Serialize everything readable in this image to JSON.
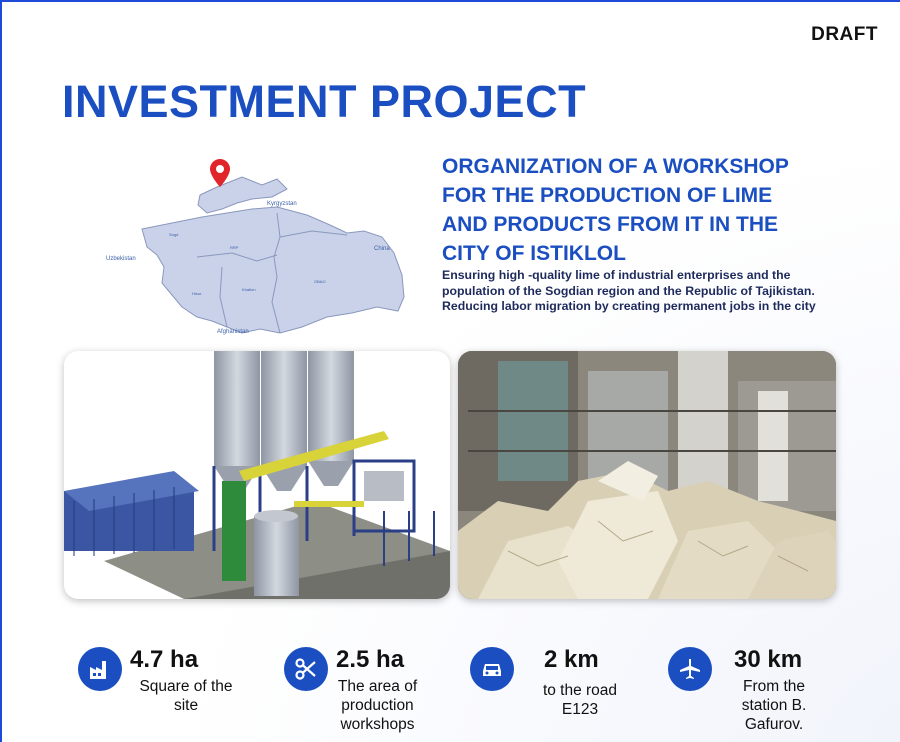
{
  "header": {
    "badge": "DRAFT",
    "title": "INVESTMENT PROJECT"
  },
  "map": {
    "labels": {
      "kyrgyzstan": "Kyrgyzstan",
      "uzbekistan": "Uzbekistan",
      "china": "China",
      "afghanistan": "Afghanistan",
      "sogd": "Sogd",
      "hisor": "Hisor",
      "khatlon": "Khatlon",
      "gbao": "GBAO",
      "rrp": "RRP"
    },
    "colors": {
      "fill": "#c9d2e8",
      "stroke": "#8a98bd",
      "pin": "#e0262b"
    }
  },
  "project": {
    "heading_lines": [
      "ORGANIZATION OF A WORKSHOP",
      "FOR THE PRODUCTION OF LIME",
      "AND PRODUCTS FROM IT IN THE",
      "CITY OF ISTIKLOL"
    ],
    "description": [
      "Ensuring high -quality lime of industrial enterprises and the population of the Sogdian region and the Republic of Tajikistan.",
      "Reducing labor migration by creating permanent jobs in the city"
    ]
  },
  "stats": [
    {
      "icon": "factory-icon",
      "value": "4.7 ha",
      "label_lines": [
        "Square of the",
        "site"
      ]
    },
    {
      "icon": "scissors-icon",
      "value": "2.5 ha",
      "label_lines": [
        "The area of",
        "production",
        "workshops"
      ]
    },
    {
      "icon": "car-icon",
      "value": "2 km",
      "label_lines": [
        "to the road",
        "E123"
      ]
    },
    {
      "icon": "airplane-icon",
      "value": "30 km",
      "label_lines": [
        "From the",
        "station B.",
        "Gafurov."
      ]
    }
  ],
  "colors": {
    "brand_blue": "#1b4fc1",
    "text_dark": "#1e2a5c"
  }
}
